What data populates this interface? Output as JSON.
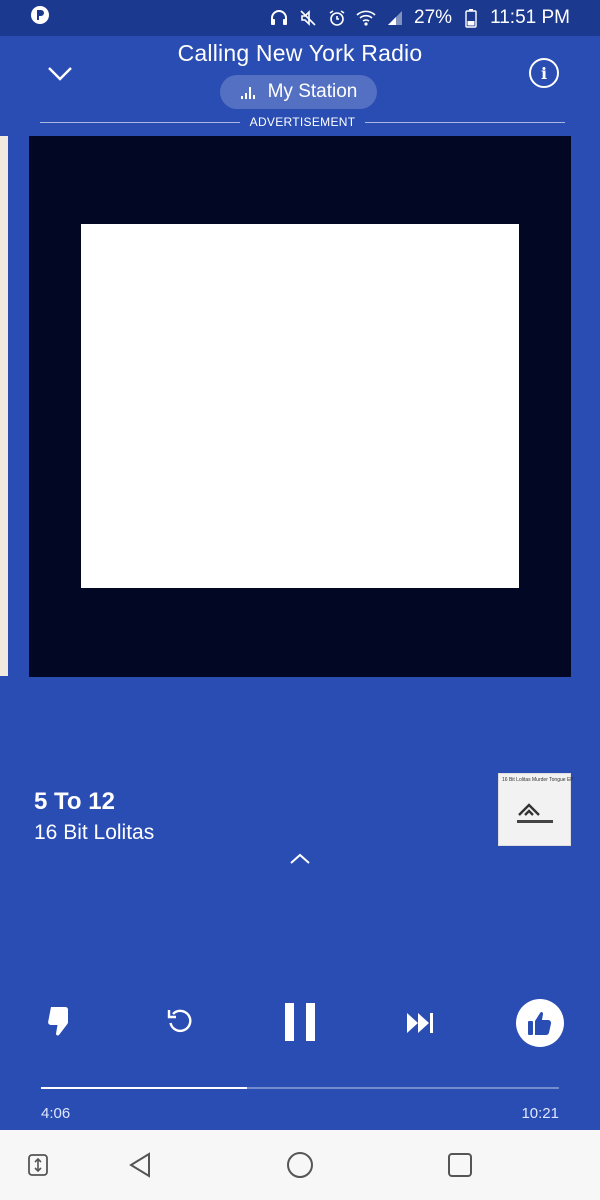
{
  "status_bar": {
    "battery": "27%",
    "time": "11:51 PM",
    "icons": [
      "pandora-icon",
      "headphones-icon",
      "mute-icon",
      "alarm-icon",
      "wifi-icon",
      "signal-icon",
      "battery-icon"
    ]
  },
  "header": {
    "station_title": "Calling New York Radio",
    "station_pill_label": "My Station",
    "ad_label": "ADVERTISEMENT"
  },
  "track": {
    "title": "5 To 12",
    "artist": "16 Bit Lolitas",
    "album_art_text": "16 Bit Lolitas Murder Tongue EP"
  },
  "player": {
    "elapsed": "4:06",
    "duration": "10:21",
    "progress": 0.397
  },
  "colors": {
    "background": "#2a4db3",
    "status_bar": "#1b3a8f",
    "ad_frame": "#020823",
    "nav_bar": "#f7f7f7"
  }
}
